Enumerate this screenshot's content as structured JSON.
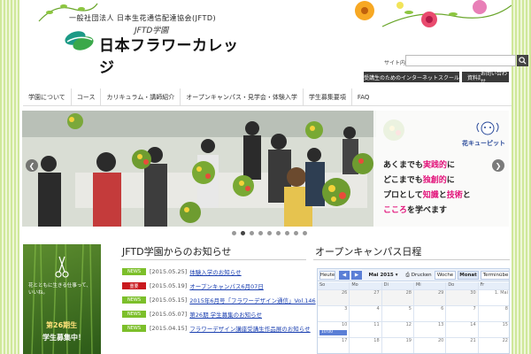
{
  "header": {
    "org_line": "一般社団法人 日本生花通信配達協会(JFTD)",
    "logo_sub": "JFTD学園",
    "logo_main": "日本フラワーカレッジ"
  },
  "search": {
    "label": "サイト内検索",
    "value": "",
    "button_icon": "search-icon"
  },
  "top_buttons": [
    "受講生のためのインターネットスクール",
    "資料請求",
    "お問い合わせ"
  ],
  "nav": {
    "items": [
      "学園について",
      "コース",
      "カリキュラム・講師紹介",
      "オープンキャンパス・見学会・体験入学",
      "学生募集要項",
      "FAQ"
    ]
  },
  "slider": {
    "lines": [
      {
        "pre": "あくまでも",
        "hl": "実践的",
        "post": "に"
      },
      {
        "pre": "どこまでも",
        "hl": "独創的",
        "post": "に"
      },
      {
        "pre": "プロとして",
        "hl": "知識",
        "mid": "と",
        "hl2": "技術",
        "post": "と"
      },
      {
        "pre": "",
        "hl": "こころ",
        "post": "を学べます"
      }
    ],
    "mascot_label": "花キューピット",
    "prev_icon": "chevron-left-icon",
    "next_icon": "chevron-right-icon",
    "dot_count": 9,
    "active_dot": 1
  },
  "banner": {
    "vertical_text": "花とともに生きる仕事って、いいね。",
    "caption1": "第26期生",
    "caption2": "学生募集中！"
  },
  "news": {
    "title": "JFTD学園からのお知らせ",
    "items": [
      {
        "badge": "NEWS",
        "badge_type": "news",
        "date": "[2015.05.25]",
        "text": "体験入学のお知らせ"
      },
      {
        "badge": "重要",
        "badge_type": "important",
        "date": "[2015.05.19]",
        "text": "オープンキャンパス6月07日"
      },
      {
        "badge": "NEWS",
        "badge_type": "news",
        "date": "[2015.05.15]",
        "text": "2015年6月号「フラワーデザイン通信」Vol.146"
      },
      {
        "badge": "NEWS",
        "badge_type": "news",
        "date": "[2015.05.07]",
        "text": "第26期 学生募集のお知らせ"
      },
      {
        "badge": "NEWS",
        "badge_type": "news",
        "date": "[2015.04.15]",
        "text": "フラワーデザイン講座受講生作品展のお知らせ"
      }
    ]
  },
  "calendar": {
    "title": "オープンキャンパス日程",
    "today_label": "Heute",
    "month_label": "Mai 2015",
    "print_label": "Drucken",
    "view_week": "Woche",
    "view_month": "Monat",
    "view_agenda": "Terminübe",
    "weekdays": [
      "So",
      "Mo",
      "Di",
      "Mi",
      "Do",
      "Fr"
    ],
    "weeks": [
      [
        {
          "d": "26",
          "o": true
        },
        {
          "d": "27",
          "o": true
        },
        {
          "d": "28",
          "o": true
        },
        {
          "d": "29",
          "o": true
        },
        {
          "d": "30",
          "o": true
        },
        {
          "d": "1. Mai",
          "o": false
        }
      ],
      [
        {
          "d": "3"
        },
        {
          "d": "4"
        },
        {
          "d": "5"
        },
        {
          "d": "6"
        },
        {
          "d": "7"
        },
        {
          "d": "8"
        }
      ],
      [
        {
          "d": "10"
        },
        {
          "d": "11"
        },
        {
          "d": "12"
        },
        {
          "d": "13"
        },
        {
          "d": "14"
        },
        {
          "d": "15"
        }
      ],
      [
        {
          "d": "17"
        },
        {
          "d": "18"
        },
        {
          "d": "19"
        },
        {
          "d": "20"
        },
        {
          "d": "21"
        },
        {
          "d": "22"
        }
      ]
    ],
    "event_label": "10:00"
  },
  "colors": {
    "accent_green": "#7cbf2a",
    "important_red": "#c9191e",
    "highlight_pink": "#e2127a",
    "link_blue": "#1a3fb0"
  }
}
